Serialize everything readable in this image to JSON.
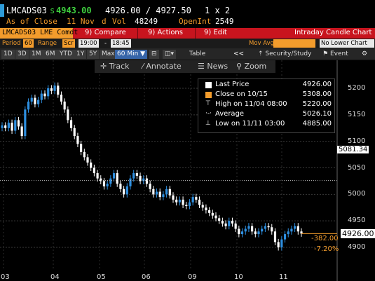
{
  "header": {
    "ticker": "LMCADS03",
    "last_price_prefix": "s",
    "last_price": "4943.00",
    "bid_ask": "4926.00 / 4927.50",
    "size": "1 x 2",
    "as_of_label": "As of Close",
    "as_of_date": "11 Nov",
    "d_label": "d",
    "vol_label": "Vol",
    "vol_value": "48249",
    "openint_label": "OpenInt",
    "openint_value": "2549"
  },
  "function_bar": {
    "security": "LMCADS03 LME Comdt",
    "compare_label": "Compare",
    "compare_num": "9)",
    "actions_label": "Actions",
    "actions_num": "9)",
    "edit_label": "Edit",
    "edit_num": "9)",
    "title": "Intraday Candle Chart"
  },
  "settings": {
    "period_label": "Period",
    "period_value": "60",
    "range_label": "Range",
    "range_value": "Scr",
    "start_time": "19:00",
    "end_time": "18:45",
    "mov_avg_label": "Mov Avg",
    "lower_chart_label": "No Lower Chart"
  },
  "range_bar": {
    "buttons": [
      "1D",
      "3D",
      "1M",
      "6M",
      "YTD",
      "1Y",
      "5Y",
      "Max"
    ],
    "interval": "60 Min",
    "table_label": "Table",
    "back_label": "<<",
    "security_study_label": "Security/Study",
    "event_label": "Event"
  },
  "toolbar": {
    "track": "Track",
    "annotate": "Annotate",
    "news": "News",
    "zoom": "Zoom"
  },
  "legend": {
    "items": [
      {
        "label": "Last Price",
        "value": "4926.00",
        "color": "#ffffff"
      },
      {
        "label": "Close on 10/15",
        "value": "5308.00",
        "color": "#f39c2c"
      },
      {
        "label": "High on 11/04 08:00",
        "value": "5220.00",
        "color": "#ffffff"
      },
      {
        "label": "Average",
        "value": "5026.10",
        "color": "#ffffff"
      },
      {
        "label": "Low on 11/11 03:00",
        "value": "4885.00",
        "color": "#ffffff"
      }
    ]
  },
  "axis_tags": {
    "average_tag": "5081.34",
    "last_tag": "4926.00",
    "change_abs": "-382.00",
    "change_pct": "-7.20%"
  },
  "colors": {
    "up": "#2e8fe0",
    "down": "#ffffff",
    "accent": "#f39c2c",
    "function_bar": "#c8141e"
  },
  "chart_data": {
    "type": "candlestick",
    "ylim": [
      4870,
      5250
    ],
    "yticks": [
      4900,
      4950,
      5000,
      5050,
      5100,
      5150,
      5200
    ],
    "xticks": [
      "03",
      "04",
      "05",
      "06",
      "09",
      "10",
      "11"
    ],
    "average": 5026.1,
    "last": 4926.0,
    "high": 5220.0,
    "low": 4885.0,
    "close_reference": 5308.0,
    "series": [
      {
        "name": "Last Price",
        "values": [
          5130,
          5125,
          5135,
          5120,
          5140,
          5128,
          5110,
          5160,
          5175,
          5182,
          5170,
          5178,
          5190,
          5185,
          5200,
          5195,
          5205,
          5188,
          5175,
          5160,
          5140,
          5125,
          5110,
          5095,
          5080,
          5070,
          5060,
          5050,
          5040,
          5030,
          5025,
          5015,
          5020,
          5030,
          5040,
          5020,
          5010,
          5000,
          5015,
          5030,
          5040,
          5035,
          5025,
          5030,
          5020,
          5010,
          5000,
          5005,
          4995,
          5000,
          5010,
          4998,
          4990,
          4985,
          4990,
          4980,
          4978,
          4985,
          4995,
          4990,
          4980,
          4975,
          4970,
          4965,
          4960,
          4955,
          4950,
          4945,
          4940,
          4950,
          4945,
          4935,
          4925,
          4930,
          4935,
          4940,
          4930,
          4925,
          4930,
          4935,
          4940,
          4938,
          4930,
          4910,
          4900,
          4915,
          4925,
          4930,
          4935,
          4940,
          4930,
          4926
        ]
      }
    ]
  }
}
